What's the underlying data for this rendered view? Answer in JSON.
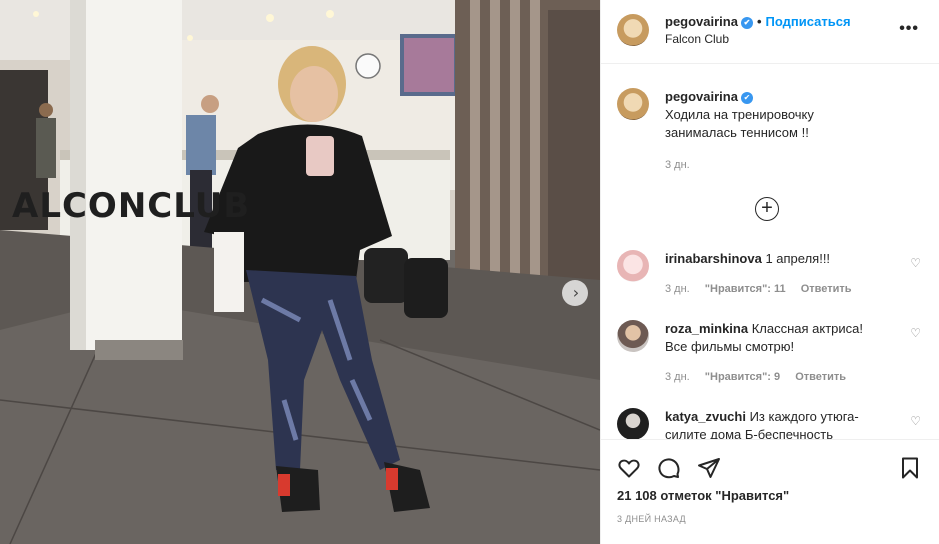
{
  "photo": {
    "label": "ALCONCLUB",
    "next_glyph": "›"
  },
  "header": {
    "username": "pegovairina",
    "verified_mark": "✔",
    "separator": "•",
    "follow": "Подписаться",
    "location": "Falcon Club",
    "more": "•••"
  },
  "caption": {
    "username": "pegovairina",
    "verified_mark": "✔",
    "text_line1": "Ходила на тренировочку",
    "text_line2": "занималась теннисом !!",
    "age": "3 дн."
  },
  "load_more": "+",
  "comments": [
    {
      "username": "irinabarshinova",
      "text": "1 апреля!!!",
      "age": "3 дн.",
      "likes": "\"Нравится\": 11",
      "reply": "Ответить"
    },
    {
      "username": "roza_minkina",
      "text": "Классная актриса! Все фильмы смотрю!",
      "age": "3 дн.",
      "likes": "\"Нравится\": 9",
      "reply": "Ответить"
    },
    {
      "username": "katya_zvuchi",
      "text": "Из каждого утюга- силите дома Б-беспечность"
    }
  ],
  "icons": {
    "heart": "heart-icon",
    "comment": "comment-icon",
    "share": "share-icon",
    "save": "bookmark-icon"
  },
  "likes_text": "21 108 отметок \"Нравится\"",
  "posted": "3 дней назад",
  "colors": {
    "link": "#0095f6",
    "verified": "#3897f0",
    "muted": "#8e8e8e"
  }
}
